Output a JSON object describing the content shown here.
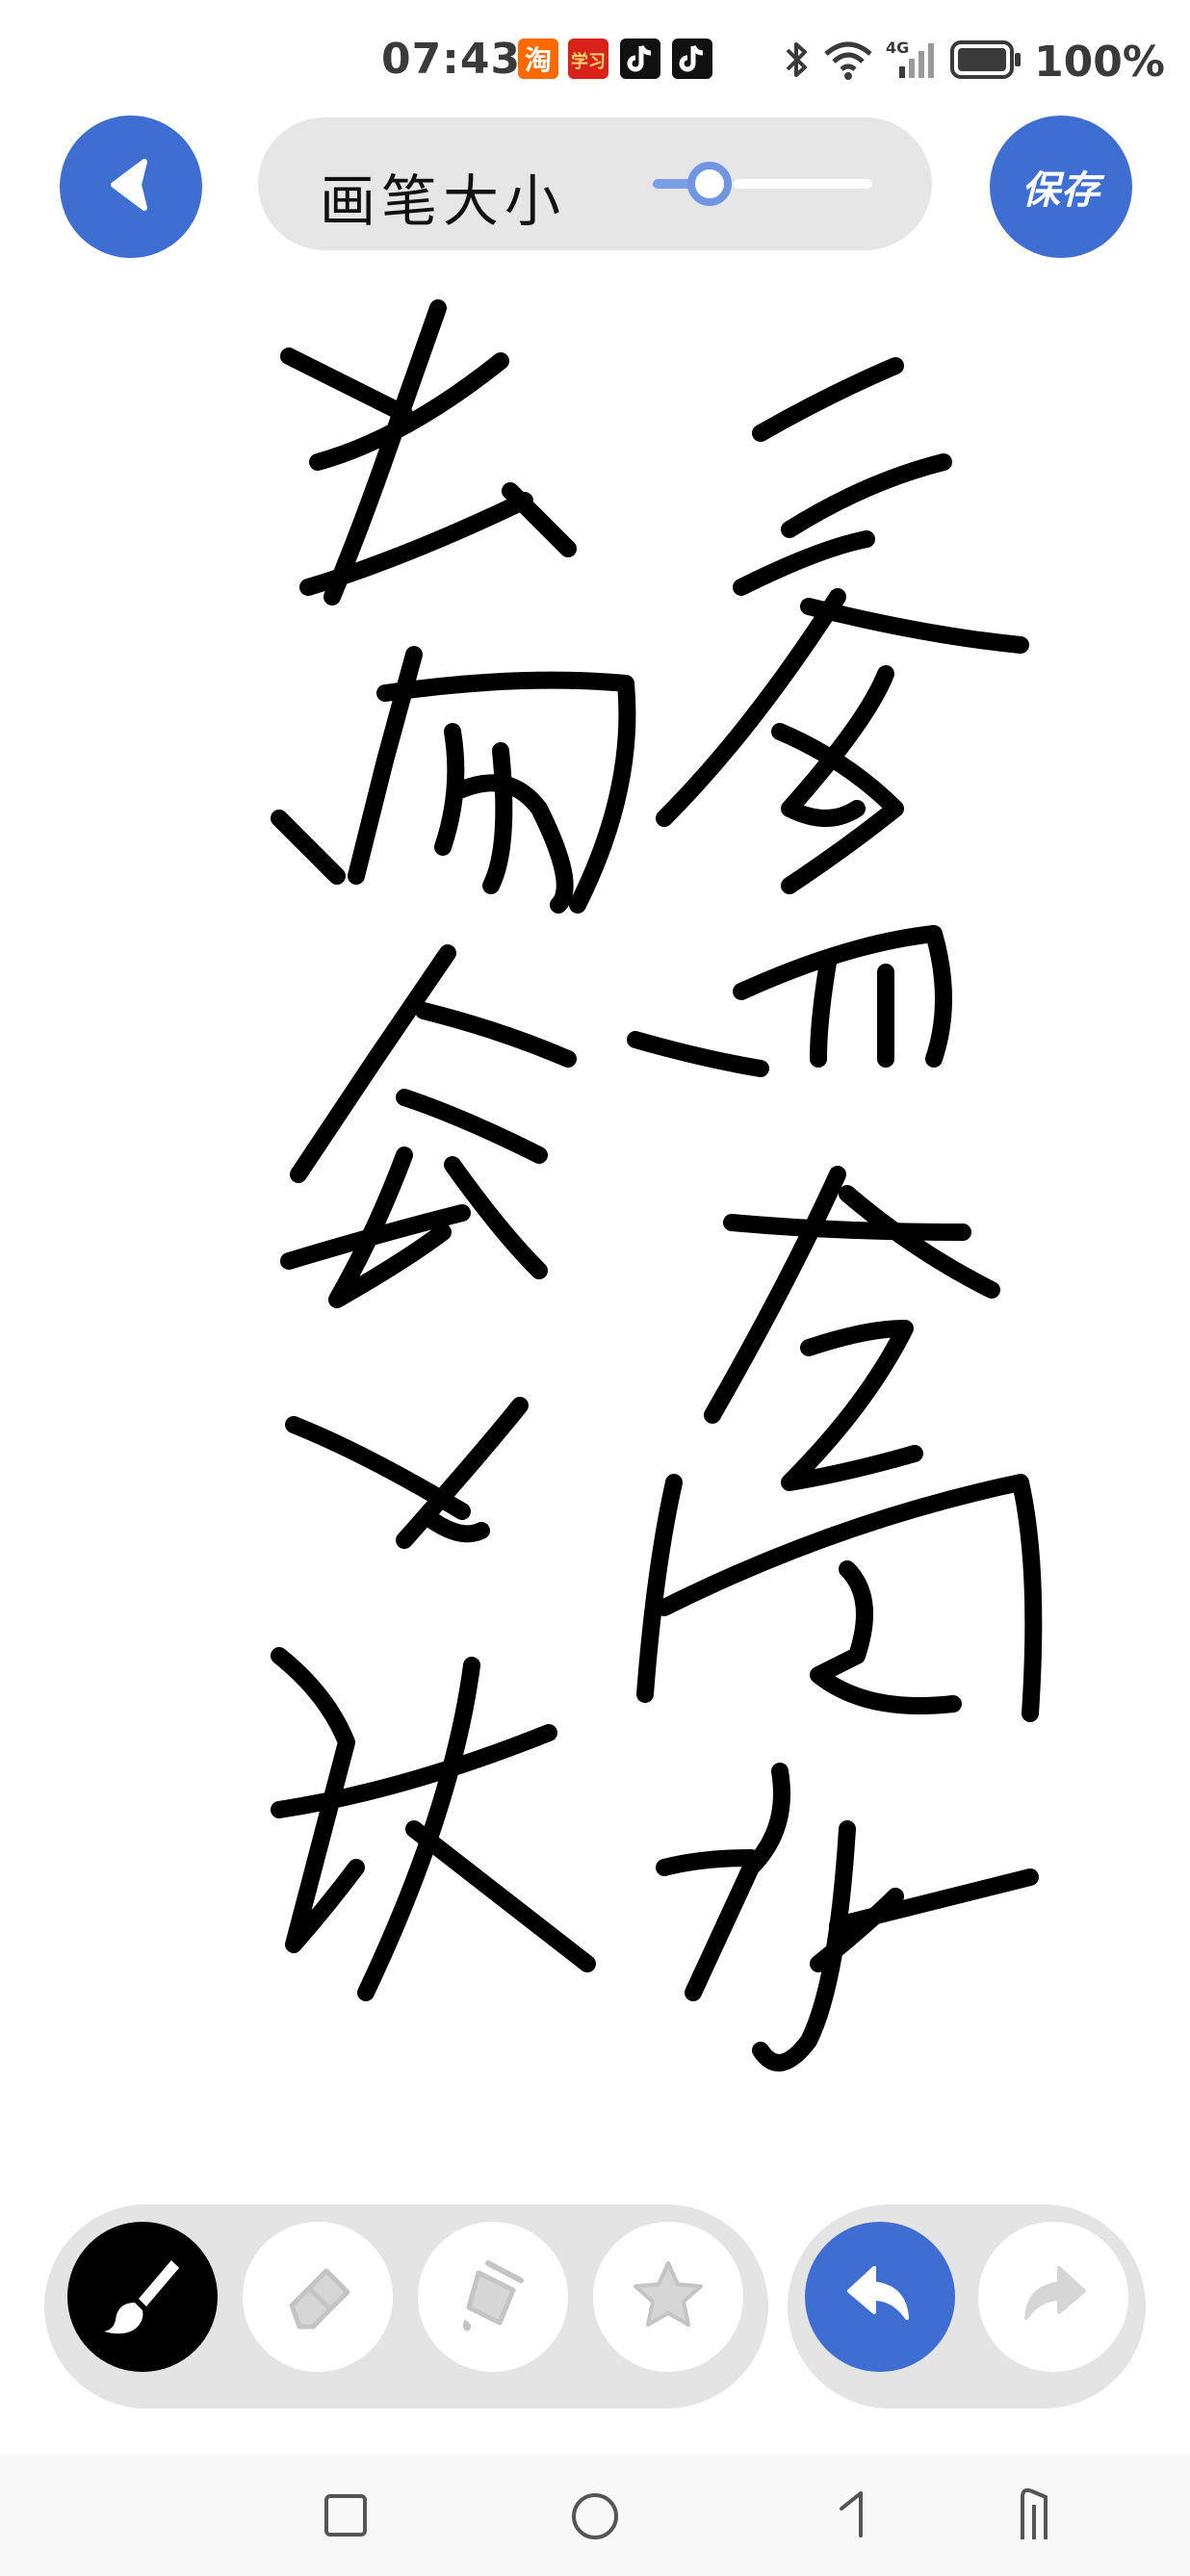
{
  "status_bar": {
    "time": "07:43",
    "app_icons": [
      "taobao-icon",
      "xuexi-icon",
      "douyin-icon",
      "douyin-icon"
    ],
    "network": "4G",
    "battery": "100%"
  },
  "header": {
    "brush_size_label": "画笔大小",
    "brush_size_level": 0.2,
    "save_label": "保存"
  },
  "toolbar": {
    "tools": [
      {
        "name": "brush-tool",
        "icon": "brush-icon",
        "active": true
      },
      {
        "name": "eraser-tool",
        "icon": "eraser-icon",
        "active": false
      },
      {
        "name": "fill-tool",
        "icon": "paint-bucket-icon",
        "active": false
      },
      {
        "name": "sticker-tool",
        "icon": "star-icon",
        "active": false
      }
    ],
    "history": [
      {
        "name": "undo-button",
        "icon": "undo-icon",
        "enabled": true
      },
      {
        "name": "redo-button",
        "icon": "redo-icon",
        "enabled": false
      }
    ]
  },
  "colors": {
    "accent": "#3f6ed2",
    "ink": "#000000",
    "panel": "#e4e4e4"
  }
}
